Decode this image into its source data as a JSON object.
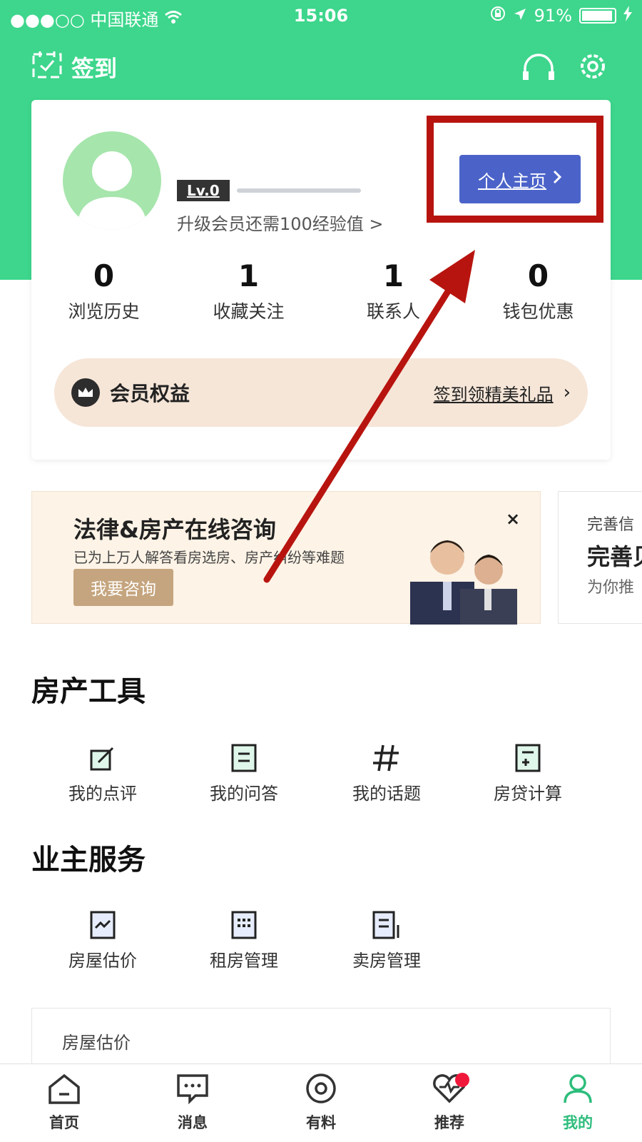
{
  "status_bar": {
    "carrier": "●●●○○ 中国联通",
    "time": "15:06",
    "battery": "91%",
    "battery_level": 0.91
  },
  "header": {
    "checkin_label": "签到",
    "icons": [
      "headset-icon",
      "gear-icon"
    ]
  },
  "profile": {
    "level": "Lv.0",
    "upgrade_text": "升级会员还需100经验值 >",
    "home_button": "个人主页",
    "stats": [
      {
        "value": "0",
        "label": "浏览历史"
      },
      {
        "value": "1",
        "label": "收藏关注"
      },
      {
        "value": "1",
        "label": "联系人"
      },
      {
        "value": "0",
        "label": "钱包优惠"
      }
    ],
    "vip": {
      "title": "会员权益",
      "link": "签到领精美礼品"
    }
  },
  "banner": {
    "title": "法律&房产在线咨询",
    "subtitle": "已为上万人解答看房选房、房产纠纷等难题",
    "button": "我要咨询",
    "close": "×"
  },
  "banner2": {
    "small": "完善信",
    "big": "完善贝",
    "desc": "为你推"
  },
  "tools_section": {
    "title": "房产工具",
    "items": [
      {
        "label": "我的点评",
        "icon": "edit-icon"
      },
      {
        "label": "我的问答",
        "icon": "document-icon"
      },
      {
        "label": "我的话题",
        "icon": "hashtag-icon"
      },
      {
        "label": "房贷计算",
        "icon": "calculator-icon"
      }
    ]
  },
  "owner_section": {
    "title": "业主服务",
    "items": [
      {
        "label": "房屋估价",
        "icon": "chart-icon"
      },
      {
        "label": "租房管理",
        "icon": "building-icon"
      },
      {
        "label": "卖房管理",
        "icon": "sell-icon"
      }
    ]
  },
  "estimate_card": {
    "title": "房屋估价"
  },
  "tabbar": {
    "items": [
      {
        "label": "首页",
        "icon": "home-icon"
      },
      {
        "label": "消息",
        "icon": "message-icon"
      },
      {
        "label": "有料",
        "icon": "target-icon"
      },
      {
        "label": "推荐",
        "icon": "heart-pulse-icon"
      },
      {
        "label": "我的",
        "icon": "user-icon"
      }
    ],
    "active_color": "#2dbd7c"
  },
  "colors": {
    "brand_green": "#3dd68c",
    "button_blue": "#4b63c9",
    "annotation_red": "#b8140f",
    "consult_button": "#c5a57f"
  }
}
